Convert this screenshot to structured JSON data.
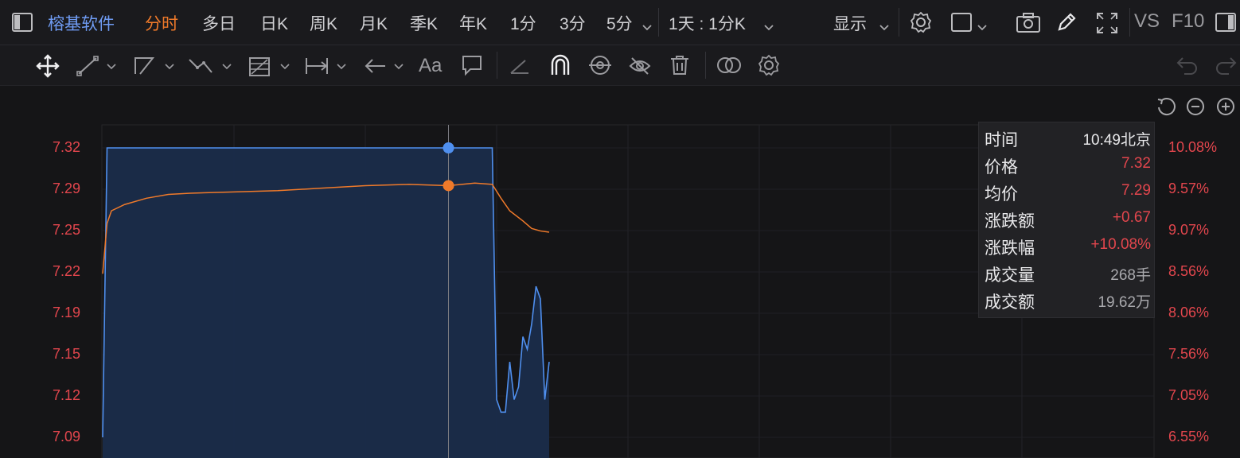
{
  "topbar": {
    "stock_name": "榕基软件",
    "tabs": [
      "分时",
      "多日",
      "日K",
      "周K",
      "月K",
      "季K",
      "年K",
      "1分",
      "3分",
      "5分"
    ],
    "active_tab": "分时",
    "period_select": "1天 : 1分K",
    "display_label": "显示",
    "vs_label": "VS",
    "f10_label": "F10"
  },
  "toolbar": {
    "text_tool_label": "Aa"
  },
  "tooltip": {
    "rows": [
      {
        "label": "时间",
        "value": "10:49北京",
        "color": "#e8e8ea"
      },
      {
        "label": "价格",
        "value": "7.32",
        "color": "#e2464d"
      },
      {
        "label": "均价",
        "value": "7.29",
        "color": "#e2464d"
      },
      {
        "label": "涨跌额",
        "value": "+0.67",
        "color": "#e2464d"
      },
      {
        "label": "涨跌幅",
        "value": "+10.08%",
        "color": "#e2464d"
      },
      {
        "label": "成交量",
        "value": "268手",
        "color": "#a9a9ad"
      },
      {
        "label": "成交额",
        "value": "19.62万",
        "color": "#a9a9ad"
      }
    ]
  },
  "colors": {
    "price_line": "#4f8fee",
    "avg_line": "#f07a2a",
    "axis_text": "#e2464d",
    "active_tab": "#f07a2a",
    "stock_name": "#6f9bf2"
  },
  "chart_data": {
    "type": "line",
    "y_left_ticks": [
      "7.32",
      "7.29",
      "7.25",
      "7.22",
      "7.19",
      "7.15",
      "7.12",
      "7.09"
    ],
    "y_right_ticks": [
      "10.08%",
      "9.57%",
      "9.07%",
      "8.56%",
      "8.06%",
      "7.56%",
      "7.05%",
      "6.55%"
    ],
    "ylim": [
      7.08,
      7.33
    ],
    "x_minutes_total": 240,
    "crosshair_minute": 79,
    "series": [
      {
        "key": "price",
        "values": [
          [
            0,
            7.09
          ],
          [
            1,
            7.32
          ],
          [
            80,
            7.32
          ],
          [
            89,
            7.32
          ],
          [
            90,
            7.12
          ],
          [
            91,
            7.11
          ],
          [
            92,
            7.11
          ],
          [
            93,
            7.15
          ],
          [
            94,
            7.12
          ],
          [
            95,
            7.13
          ],
          [
            96,
            7.17
          ],
          [
            97,
            7.16
          ],
          [
            98,
            7.18
          ],
          [
            99,
            7.21
          ],
          [
            100,
            7.2
          ],
          [
            101,
            7.12
          ],
          [
            102,
            7.15
          ]
        ]
      },
      {
        "key": "average",
        "values": [
          [
            0,
            7.22
          ],
          [
            1,
            7.26
          ],
          [
            2,
            7.27
          ],
          [
            5,
            7.275
          ],
          [
            10,
            7.28
          ],
          [
            15,
            7.283
          ],
          [
            20,
            7.284
          ],
          [
            30,
            7.285
          ],
          [
            40,
            7.286
          ],
          [
            50,
            7.288
          ],
          [
            60,
            7.29
          ],
          [
            70,
            7.291
          ],
          [
            79,
            7.29
          ],
          [
            85,
            7.292
          ],
          [
            89,
            7.291
          ],
          [
            91,
            7.28
          ],
          [
            93,
            7.27
          ],
          [
            96,
            7.262
          ],
          [
            98,
            7.256
          ],
          [
            100,
            7.254
          ],
          [
            102,
            7.253
          ]
        ]
      }
    ],
    "crosshair_points": {
      "price": 7.32,
      "average": 7.29
    }
  }
}
